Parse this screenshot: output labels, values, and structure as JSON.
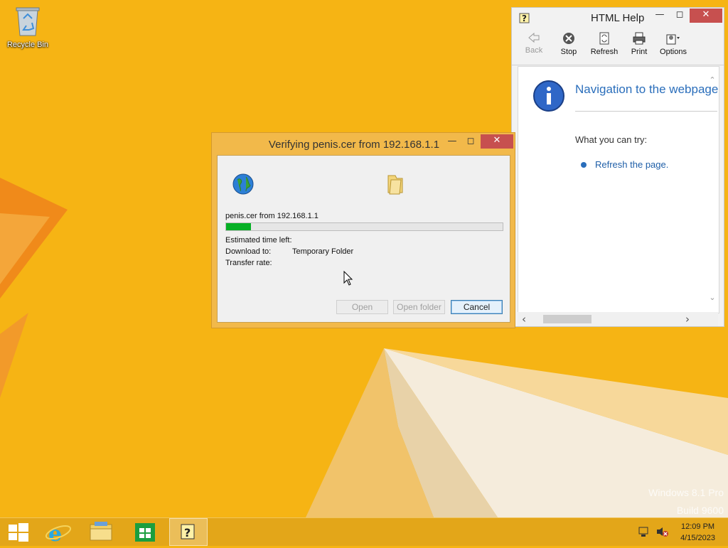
{
  "desktop": {
    "recycle_bin_label": "Recycle Bin",
    "watermark_line1": "Windows 8.1 Pro",
    "watermark_line2": "Build 9600"
  },
  "help_window": {
    "title": "HTML Help",
    "toolbar": {
      "back": "Back",
      "stop": "Stop",
      "refresh": "Refresh",
      "print": "Print",
      "options": "Options"
    },
    "content": {
      "heading": "Navigation to the webpage was canceled",
      "what_you_can_try": "What you can try:",
      "refresh_link": "Refresh the page."
    }
  },
  "download_dialog": {
    "title": "Verifying penis.cer from 192.168.1.1",
    "file_source": "penis.cer from 192.168.1.1",
    "progress_fraction": 0.09,
    "estimated_time_label": "Estimated time left:",
    "download_to_label": "Download to:",
    "download_to_value": "Temporary Folder",
    "transfer_rate_label": "Transfer rate:",
    "buttons": {
      "open": "Open",
      "open_folder": "Open folder",
      "cancel": "Cancel"
    }
  },
  "taskbar": {
    "clock_time": "12:09 PM",
    "clock_date": "4/15/2023"
  },
  "colors": {
    "desktop_bg": "#f6b414",
    "dialog_frame": "#f2b94a",
    "progress_fill": "#06b025",
    "close_button": "#c7504f",
    "link": "#1f5fa8"
  }
}
